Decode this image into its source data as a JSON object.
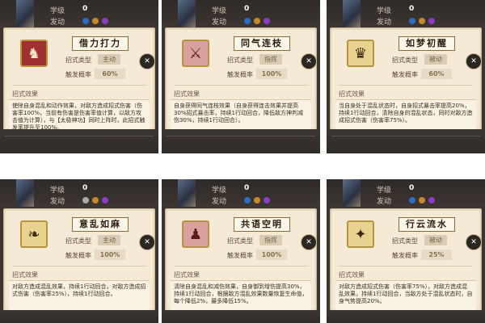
{
  "header_labels": {
    "stat1": "学级",
    "stat2": "发动"
  },
  "field_labels": {
    "type": "招式类型",
    "prob": "触发概率",
    "section": "招式效果"
  },
  "close_glyph": "✕",
  "skills": [
    {
      "name": "借力打力",
      "type": "主动",
      "prob": "60%",
      "level": "0",
      "icon_glyph": "♞",
      "desc": "使除自身混乱和动作效果，对敌方造成招式伤害（伤害率100%，当前有伤害是伤害率值计算，以敌方攻击值为计算），与【太极神功】同时上阵时，此招式触发率提升至100%。"
    },
    {
      "name": "同气连枝",
      "type": "指挥",
      "prob": "100%",
      "level": "0",
      "icon_glyph": "⚔",
      "desc": "自身获得同气连枝效果（自身获得连击效果并提高30%招式暴击率，持续1行动回合，降低敌方神判减伤30%，持续1行动回合）。"
    },
    {
      "name": "如梦初醒",
      "type": "被动",
      "prob": "60%",
      "level": "0",
      "icon_glyph": "♛",
      "desc": "当自身处于混乱状态时，自身招式暴击率提高20%，持续1行动回合，清除自身的混乱状态，同时对敌方造成招式伤害（伤害率75%）。"
    },
    {
      "name": "意乱如麻",
      "type": "主动",
      "prob": "100%",
      "level": "0",
      "icon_glyph": "❧",
      "desc": "对敌方造成混乱效果，持续1行动回合，对敌方造成招式伤害（伤害率25%），持续1行动回合。"
    },
    {
      "name": "共语空明",
      "type": "指挥",
      "prob": "100%",
      "level": "0",
      "icon_glyph": "♟",
      "desc": "清除自身混乱和减伤效果，自身御到增伤提高30%，持续1行动回合，根据敌方混乱效果数量恢复生命值，每个降低2%，最多降低15%。"
    },
    {
      "name": "行云流水",
      "type": "被动",
      "prob": "25%",
      "level": "0",
      "icon_glyph": "✦",
      "desc": "对敌方造成招式伤害（伤害率75%），对敌方造成混乱效果，持续1行动回合，当敌方处于混乱状态时，自身气势提高20%。"
    }
  ],
  "colors": {
    "accent_blue": "#2e5ec4",
    "card_bg": "#f4ead6",
    "frame_dark": "#3a3530"
  }
}
